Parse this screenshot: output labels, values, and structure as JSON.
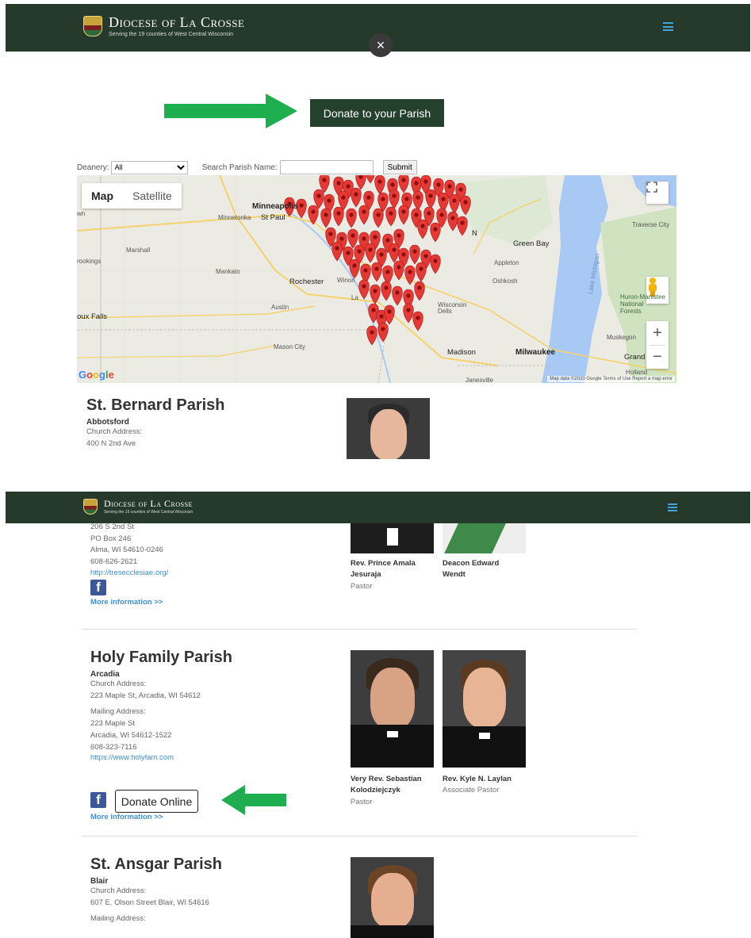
{
  "header": {
    "name": "Diocese of La Crosse",
    "tagline": "Serving the 19 counties of West Central Wisconsin"
  },
  "close_label": "×",
  "donate_parish_label": "Donate to your Parish",
  "filters": {
    "deanery_label": "Deanery:",
    "deanery_value": "All",
    "search_label": "Search Parish Name:",
    "submit_label": "Submit"
  },
  "map": {
    "map_label": "Map",
    "satellite_label": "Satellite",
    "labels": {
      "minneapolis": "Minneapolis",
      "stpaul": "St Paul",
      "minnetonka": "Minnetonka",
      "marshall": "Marshall",
      "mankato": "Mankato",
      "rochester": "Rochester",
      "austin": "Austin",
      "siouxfalls": "oux Falls",
      "masoncity": "Mason City",
      "greenbay": "Green Bay",
      "appleton": "Appleton",
      "oshkosh": "Oshkosh",
      "madison": "Madison",
      "milwaukee": "Milwaukee",
      "muskegon": "Muskegon",
      "grand": "Grand",
      "huron": "Huron-Manistee National Forests",
      "traverse": "Traverse City",
      "lakemichigan": "Lake Michigan",
      "janesville": "Janesville",
      "holland": "Holland",
      "brookings": "rookings",
      "wn": "wn",
      "n": "N",
      "la": "La",
      "winona": "Winon",
      "wisdells": "Wisconsin Dells"
    },
    "google": "Google",
    "attribution": "Map data ©2020 Google  Terms of Use  Report a map error"
  },
  "parish1": {
    "name": "St. Bernard Parish",
    "town": "Abbotsford",
    "church_label": "Church Address:",
    "address": "400 N 2nd Ave"
  },
  "parish_prev": {
    "lines": [
      "206 S 2nd St",
      "PO Box 246",
      "Alma, WI 54610-0246",
      "608-626-2621"
    ],
    "url": "http://tresecclesiae.org/",
    "more": "More information >>",
    "clergy": [
      {
        "name": "Rev. Prince Amala Jesuraja",
        "role": "Pastor"
      },
      {
        "name": "Deacon Edward Wendt",
        "role": ""
      }
    ]
  },
  "parish2": {
    "name": "Holy Family Parish",
    "town": "Arcadia",
    "church_label": "Church Address:",
    "church_address": "223 Maple St, Arcadia, WI 54612",
    "mailing_label": "Mailing Address:",
    "mailing_lines": [
      "223 Maple St",
      "Arcadia, WI 54612-1522",
      "608-323-7116"
    ],
    "url": "https://www.holyfam.com",
    "donate_online": "Donate Online",
    "more": "More information >>",
    "clergy": [
      {
        "name": "Very Rev. Sebastian Kolodziejczyk",
        "role": "Pastor"
      },
      {
        "name": "Rev. Kyle N. Laylan",
        "role": "Associate Pastor"
      }
    ]
  },
  "parish3": {
    "name": "St. Ansgar Parish",
    "town": "Blair",
    "church_label": "Church Address:",
    "church_address": "607 E. Olson Street Blair, WI 54616",
    "mailing_label": "Mailing Address:"
  },
  "colors": {
    "header": "#263a2b",
    "accent": "#23412c",
    "arrow": "#1fae4f",
    "pin": "#e53935",
    "link": "#3f8fd0"
  }
}
